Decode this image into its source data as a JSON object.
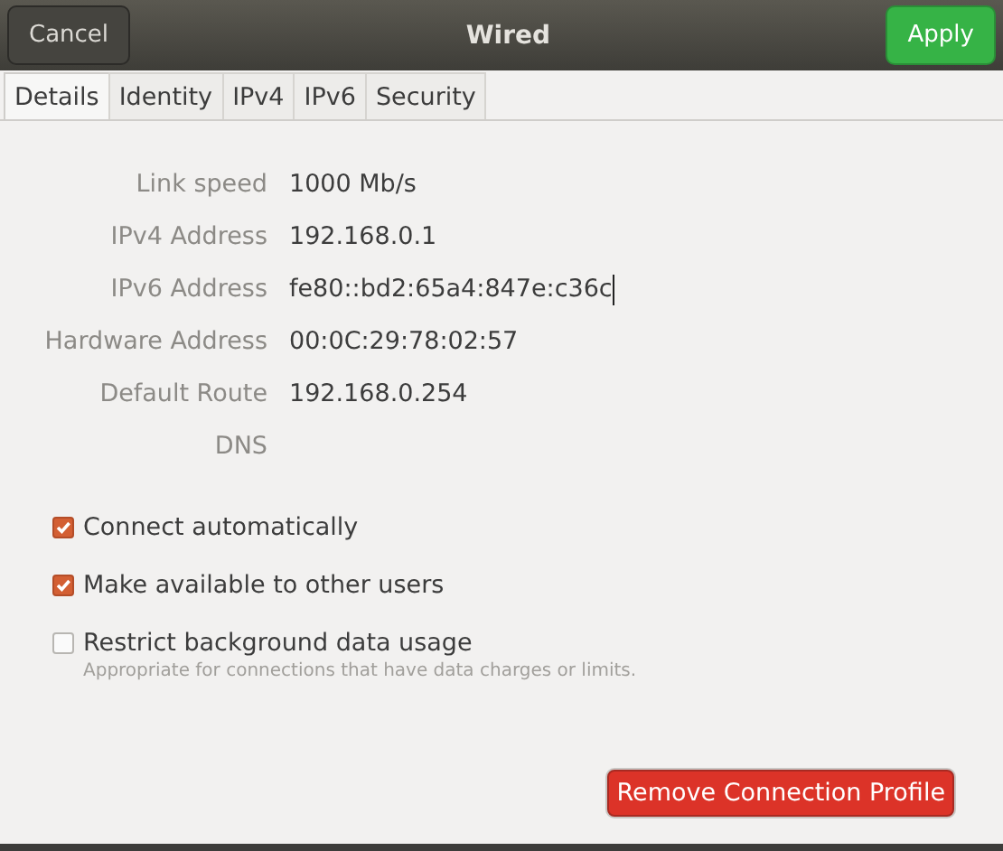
{
  "header": {
    "cancel": "Cancel",
    "title": "Wired",
    "apply": "Apply"
  },
  "tabs": [
    {
      "label": "Details",
      "selected": true
    },
    {
      "label": "Identity",
      "selected": false
    },
    {
      "label": "IPv4",
      "selected": false
    },
    {
      "label": "IPv6",
      "selected": false
    },
    {
      "label": "Security",
      "selected": false
    }
  ],
  "details": [
    {
      "label": "Link speed",
      "value": "1000 Mb/s",
      "caret": false
    },
    {
      "label": "IPv4 Address",
      "value": "192.168.0.1",
      "caret": false
    },
    {
      "label": "IPv6 Address",
      "value": "fe80::bd2:65a4:847e:c36c",
      "caret": true
    },
    {
      "label": "Hardware Address",
      "value": "00:0C:29:78:02:57",
      "caret": false
    },
    {
      "label": "Default Route",
      "value": "192.168.0.254",
      "caret": false
    },
    {
      "label": "DNS",
      "caret": false
    }
  ],
  "options": [
    {
      "label": "Connect automatically",
      "checked": true
    },
    {
      "label": "Make available to other users",
      "checked": true
    },
    {
      "label": "Restrict background data usage",
      "checked": false,
      "hint": "Appropriate for connections that have data charges or limits."
    }
  ],
  "remove_button": "Remove Connection Profile"
}
